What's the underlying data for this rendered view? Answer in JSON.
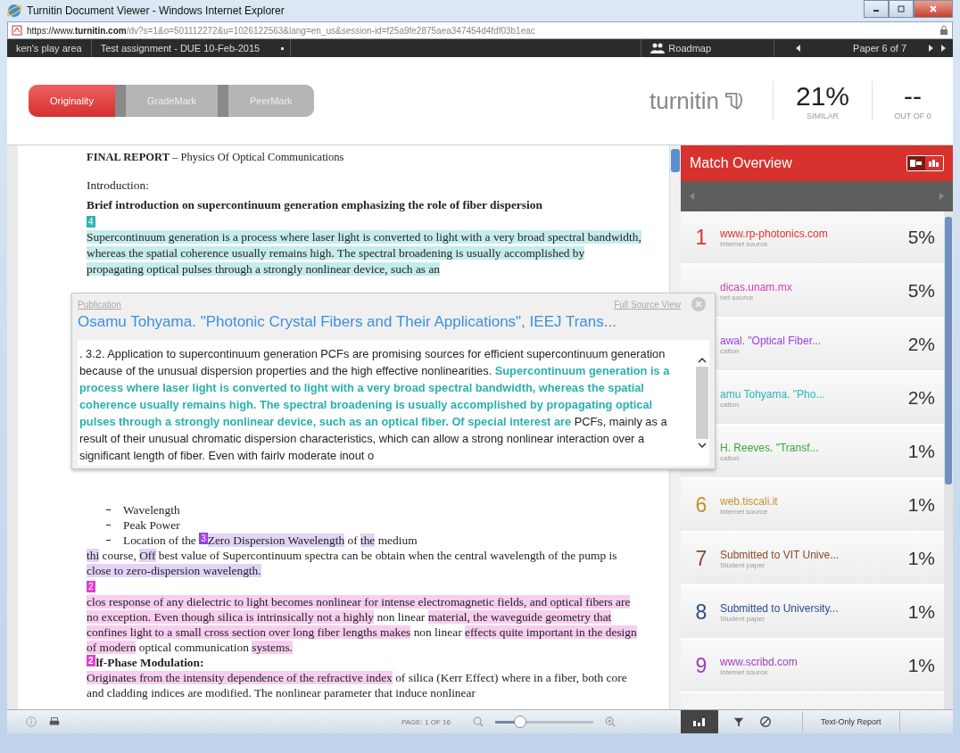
{
  "window": {
    "title": "Turnitin Document Viewer - Windows Internet Explorer"
  },
  "address_bar": {
    "url_prefix": "https://www.",
    "url_domain": "turnitin.com",
    "url_rest": "/dv?s=1&o=501112272&u=1026122563&lang=en_us&session-id=f25a9fe2875aea347454d4fdf03b1eac"
  },
  "nav_bar": {
    "class_name": "ken's play area",
    "assignment": "Test assignment - DUE 10-Feb-2015",
    "roadmap": "Roadmap",
    "paper": "Paper 6 of 7"
  },
  "tabs": [
    {
      "label": "Originality",
      "selected": true
    },
    {
      "label": "GradeMark",
      "selected": false
    },
    {
      "label": "PeerMark",
      "selected": false
    }
  ],
  "brand": "turnitin",
  "similarity": {
    "value": "21%",
    "label": "SIMILAR"
  },
  "grade": {
    "value": "--",
    "label": "OUT OF 0"
  },
  "document_top": [
    {
      "kind": "title",
      "text": "**FINAL REPORT** – Physics Of Optical Communications"
    },
    {
      "kind": "plain",
      "text": "Introduction:"
    },
    {
      "kind": "heading",
      "text": "Brief introduction on supercontinuum generation emphasizing the role of fiber dispersion"
    },
    {
      "kind": "para",
      "segments": [
        {
          "marker": "4",
          "color": "#2bb5b5"
        },
        {
          "text": "Supercontinuum generation is a process where laser light is converted to light with a very broad spectral bandwidth, whereas the spatial coherence usually remains high. The spectral broadening is usually accomplished by propagating optical pulses through a strongly nonlinear device, such as an",
          "color": "#c5ecec"
        }
      ]
    }
  ],
  "document_bottom": [
    {
      "kind": "bullet",
      "segments": [
        {
          "text": "Wavelength"
        }
      ]
    },
    {
      "kind": "bullet",
      "segments": [
        {
          "text": "Peak Power"
        }
      ]
    },
    {
      "kind": "bullet",
      "segments": [
        {
          "text": "Location of the "
        },
        {
          "marker": "3",
          "color": "#9b3fe8"
        },
        {
          "text": "Zero Dispersion Wavelength",
          "color": "#e3d3f7"
        },
        {
          "text": " of "
        },
        {
          "text": "the",
          "color": "#e3d3f7"
        },
        {
          "text": " medium"
        }
      ]
    },
    {
      "kind": "para",
      "segments": [
        {
          "text": "thi",
          "color": "#e3d3f7"
        },
        {
          "text": " course, "
        },
        {
          "text": "Off",
          "color": "#e3d3f7"
        },
        {
          "text": " best value of Supercontinuum spectra can be obtain when the central wavelength of the pump is "
        },
        {
          "text": "close to zero-dispersion wavelength.",
          "color": "#e3d3f7"
        }
      ]
    },
    {
      "kind": "para",
      "segments": [
        {
          "marker": "2",
          "color": "#e040d0"
        },
        {
          "text": "clos response of any dielectric to light becomes nonlinear for intense electromagnetic fields, and optical fibers are no exception. Even though silica is intrinsically not a highly",
          "color": "#f7cdf0"
        },
        {
          "text": " non linear "
        },
        {
          "text": "material, the waveguide geometry that confines light to a small cross section over long fiber lengths makes",
          "color": "#f7cdf0"
        },
        {
          "text": " non linear "
        },
        {
          "text": "effects quite important in the design of modern",
          "color": "#f7cdf0"
        },
        {
          "text": " optical communication "
        },
        {
          "text": "systems.",
          "color": "#f7cdf0"
        }
      ]
    },
    {
      "kind": "heading",
      "segments": [
        {
          "marker": "2",
          "color": "#e040d0"
        },
        {
          "text": "lf-Phase Modulation"
        },
        {
          "text": ":"
        }
      ]
    },
    {
      "kind": "para",
      "segments": [
        {
          "text": "Originates from the intensity dependence of the refractive index",
          "color": "#f7cdf0"
        },
        {
          "text": " of silica (Kerr Effect) where in a fiber, both core and cladding indices are modified. The nonlinear parameter that induce nonlinear"
        }
      ]
    }
  ],
  "source_popup": {
    "category": "Publication",
    "full_source_link": "Full Source View",
    "title": "Osamu Tohyama. \"Photonic Crystal Fibers and Their Applications\", IEEJ Trans...",
    "excerpt": [
      {
        "text": ". 3.2. Application to supercontinuum generation PCFs are promising sources for efficient supercontinuum generation because of the unusual dispersion properties and the high effective nonlinearities. ",
        "matched": false
      },
      {
        "text": "Supercontinuum generation is a process where laser light is converted to light with a very broad spectral bandwidth, whereas the spatial coherence usually remains high. The spectral broadening is usually accomplished by propagating optical pulses through a strongly nonlinear device, such as an optical fiber. Of special interest are",
        "matched": true
      },
      {
        "text": " PCFs, mainly as a result of their unusual chromatic dispersion characteristics, which can allow a strong nonlinear interaction over a significant length of fiber. Even with fairlv moderate inout o",
        "matched": false
      }
    ]
  },
  "match_overview": {
    "title": "Match Overview",
    "view_modes": [
      {
        "selected": true
      },
      {
        "selected": false
      }
    ],
    "matches": [
      {
        "number": "1",
        "source": "www.rp-photonics.com",
        "type": "Internet source",
        "percent": "5%",
        "color": "#d9342b"
      },
      {
        "source": "dicas.unam.mx",
        "type": "net source",
        "percent": "5%",
        "color": "#d63fb8"
      },
      {
        "source": "awal. \"Optical Fiber...",
        "type": "cation",
        "percent": "2%",
        "color": "#9b3fe8"
      },
      {
        "source": "amu Tohyama. \"Pho...",
        "type": "cation",
        "percent": "2%",
        "color": "#2bb5b5"
      },
      {
        "source": "H. Reeves. \"Transf...",
        "type": "cation",
        "percent": "1%",
        "color": "#3aa63a"
      },
      {
        "number": "6",
        "source": "web.tiscali.it",
        "type": "Internet source",
        "percent": "1%",
        "color": "#c8902a"
      },
      {
        "number": "7",
        "source": "Submitted to VIT Unive...",
        "type": "Student paper",
        "percent": "1%",
        "color": "#8a4a2a"
      },
      {
        "number": "8",
        "source": "Submitted to University...",
        "type": "Student paper",
        "percent": "1%",
        "color": "#2a4a8a"
      },
      {
        "number": "9",
        "source": "www.scribd.com",
        "type": "Internet source",
        "percent": "1%",
        "color": "#a040c0"
      }
    ]
  },
  "bottom_bar": {
    "page": "PAGE: 1 OF 16",
    "zoom": {
      "level": 0.25
    },
    "report_button": "Text-Only Report"
  }
}
